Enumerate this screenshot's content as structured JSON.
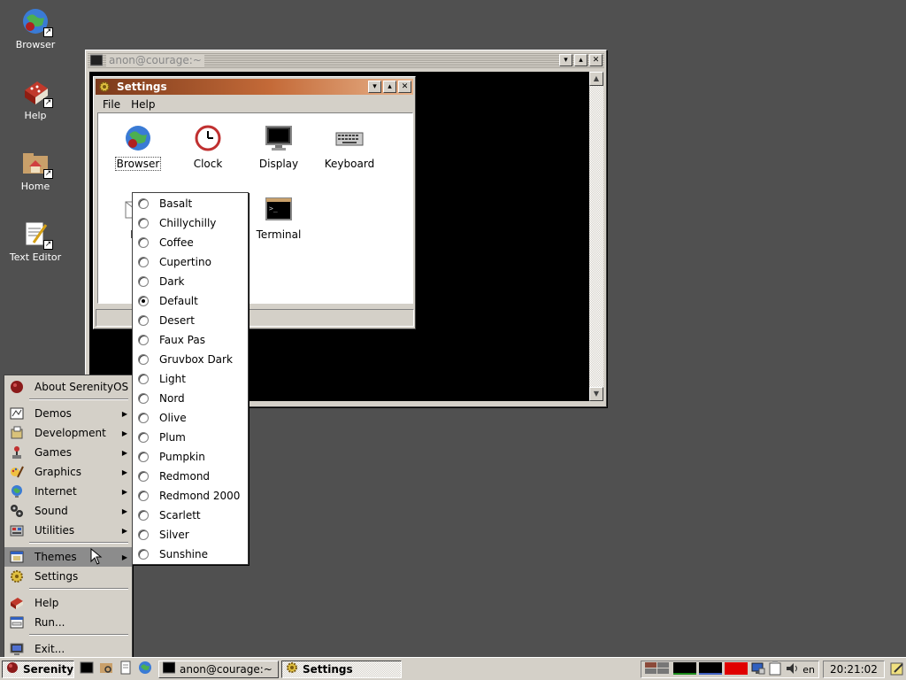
{
  "desktop": {
    "icons": [
      {
        "label": "Browser",
        "icon": "globe-icon"
      },
      {
        "label": "Help",
        "icon": "help-book-icon"
      },
      {
        "label": "Home",
        "icon": "home-folder-icon"
      },
      {
        "label": "Text Editor",
        "icon": "text-editor-icon"
      }
    ]
  },
  "terminal_window": {
    "title": "anon@courage:~",
    "controls": {
      "minimize": "▾",
      "maximize": "▴",
      "close": "✕"
    }
  },
  "settings_window": {
    "title": "Settings",
    "menu": [
      "File",
      "Help"
    ],
    "apps": [
      {
        "label": "Browser",
        "icon": "globe-icon"
      },
      {
        "label": "Clock",
        "icon": "clock-icon"
      },
      {
        "label": "Display",
        "icon": "display-icon"
      },
      {
        "label": "Keyboard",
        "icon": "keyboard-icon"
      },
      {
        "label": "Ma",
        "icon": "mail-icon"
      },
      {
        "label": "Terminal",
        "icon": "terminal-icon"
      }
    ]
  },
  "start_menu": {
    "about": "About SerenityOS",
    "categories": [
      "Demos",
      "Development",
      "Games",
      "Graphics",
      "Internet",
      "Sound",
      "Utilities"
    ],
    "themes": "Themes",
    "settings": "Settings",
    "help": "Help",
    "run": "Run...",
    "exit": "Exit..."
  },
  "themes_menu": {
    "items": [
      "Basalt",
      "Chillychilly",
      "Coffee",
      "Cupertino",
      "Dark",
      "Default",
      "Desert",
      "Faux Pas",
      "Gruvbox Dark",
      "Light",
      "Nord",
      "Olive",
      "Plum",
      "Pumpkin",
      "Redmond",
      "Redmond 2000",
      "Scarlett",
      "Silver",
      "Sunshine"
    ],
    "selected": "Default"
  },
  "taskbar": {
    "start_label": "Serenity",
    "tasks": [
      {
        "label": "anon@courage:~",
        "icon": "terminal-icon",
        "active": false
      },
      {
        "label": "Settings",
        "icon": "settings-gear-icon",
        "active": true
      }
    ],
    "keyboard_layout": "en",
    "clock": "20:21:02"
  },
  "colors": {
    "desktop": "#505050",
    "active_title": "#c46a38",
    "window": "#d4d0c8"
  }
}
